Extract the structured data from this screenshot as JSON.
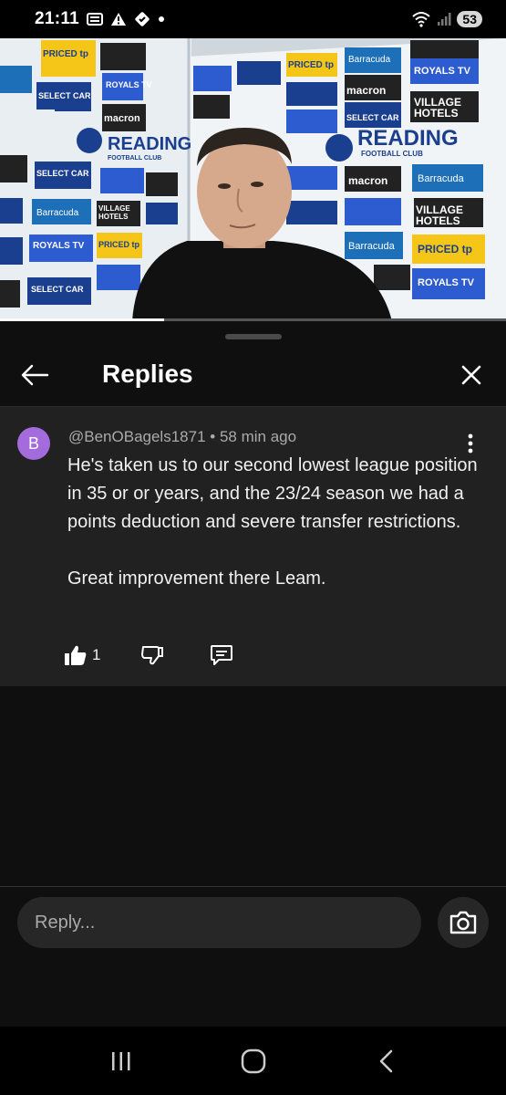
{
  "status_bar": {
    "time": "21:11",
    "battery": "53"
  },
  "video": {
    "sponsor_boards": [
      "PRICED tp",
      "SELECT CAR",
      "macron",
      "ROYALS TV",
      "Barracuda",
      "VILLAGE HOTELS",
      "READING",
      "FOOTBALL CLUB"
    ]
  },
  "sheet": {
    "title": "Replies"
  },
  "comment": {
    "avatar_letter": "B",
    "author": "@BenOBagels1871",
    "time": "58 min ago",
    "paragraph_1": "He's taken us to our second lowest league position in 35 or or years, and the 23/24 season we had a points deduction and severe transfer restrictions.",
    "paragraph_2": "Great improvement there Leam.",
    "like_count": "1"
  },
  "reply": {
    "placeholder": "Reply..."
  },
  "colors": {
    "background": "#0f0f0f",
    "card": "#212121",
    "avatar": "#a46bdc"
  }
}
